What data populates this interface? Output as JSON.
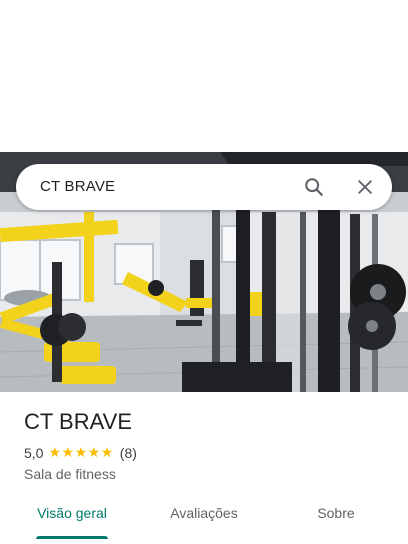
{
  "search": {
    "query": "CT BRAVE",
    "search_icon": "search-icon",
    "close_icon": "close-icon"
  },
  "place": {
    "name": "CT BRAVE",
    "rating": "5,0",
    "stars": 5,
    "reviews": "(8)",
    "category": "Sala de fitness"
  },
  "tabs": [
    {
      "label": "Visão geral",
      "active": true
    },
    {
      "label": "Avaliações",
      "active": false
    },
    {
      "label": "Sobre",
      "active": false
    }
  ],
  "colors": {
    "accent": "#00796b",
    "star": "#fbbc04",
    "equipment_yellow": "#f2d21b"
  }
}
